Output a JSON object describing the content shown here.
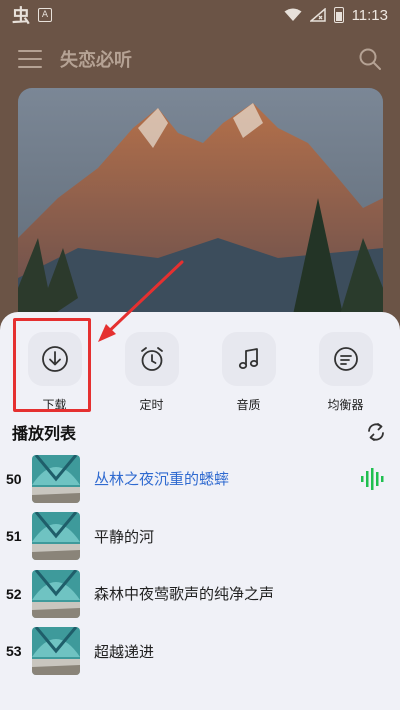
{
  "status_bar": {
    "app_glyph": "虫",
    "a_glyph": "A",
    "time": "11:13"
  },
  "header": {
    "title": "失恋必听"
  },
  "actions": [
    {
      "label": "下载",
      "icon": "download-icon"
    },
    {
      "label": "定时",
      "icon": "alarm-clock-icon"
    },
    {
      "label": "音质",
      "icon": "music-note-icon"
    },
    {
      "label": "均衡器",
      "icon": "equalizer-icon"
    }
  ],
  "playlist": {
    "title": "播放列表",
    "tracks": [
      {
        "number": "50",
        "title": "丛林之夜沉重的蟋蟀",
        "playing": true
      },
      {
        "number": "51",
        "title": "平静的河",
        "playing": false
      },
      {
        "number": "52",
        "title": "森林中夜莺歌声的纯净之声",
        "playing": false
      },
      {
        "number": "53",
        "title": "超越递进",
        "playing": false
      }
    ]
  },
  "colors": {
    "background": "#6b5446",
    "sheet": "#f0f1f7",
    "active_track": "#2f6ad0",
    "highlight": "#e53030",
    "equalizer_green": "#1fbf4f"
  }
}
